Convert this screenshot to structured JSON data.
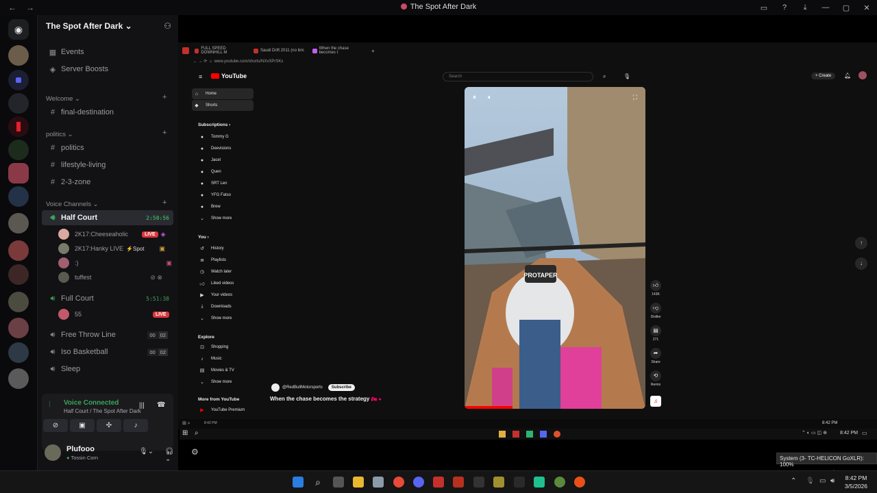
{
  "window": {
    "title": "The Spot After Dark"
  },
  "guild": {
    "name": "The Spot After Dark",
    "invite_icon": "add-person-icon"
  },
  "top_items": [
    {
      "label": "Events",
      "icon": "calendar-icon"
    },
    {
      "label": "Server Boosts",
      "icon": "boost-icon"
    }
  ],
  "categories": {
    "welcome": "Welcome",
    "politics": "politics",
    "voice": "Voice Channels"
  },
  "channels": {
    "final_destination": "final-destination",
    "politics": "politics",
    "lifestyle": "lifestyle-living",
    "zone": "2-3-zone"
  },
  "voice_channels": {
    "half_court": {
      "name": "Half Court",
      "timer": "2:50:56"
    },
    "full_court": {
      "name": "Full Court",
      "timer": "5:51:38"
    },
    "free_throw": {
      "name": "Free Throw Line",
      "a": "00",
      "b": "02"
    },
    "iso": {
      "name": "Iso Basketball",
      "a": "00",
      "b": "02"
    },
    "sleep": {
      "name": "Sleep"
    }
  },
  "voice_users": [
    {
      "name": "2K17:Cheeseaholic",
      "badge": "LIVE"
    },
    {
      "name": "2K17:Hanky LIVE",
      "tag": "Spot"
    },
    {
      "name": ":)"
    },
    {
      "name": "tuffest"
    }
  ],
  "full_court_users": [
    {
      "name": "55",
      "badge": "LIVE"
    }
  ],
  "voice_panel": {
    "status": "Voice Connected",
    "location": "Half Court / The Spot After Dark"
  },
  "user": {
    "name": "Plufooo",
    "status": "Tossin Corn"
  },
  "browser": {
    "tabs": [
      "FULL SPEED DOWNHILL M",
      "Saudi Drift 2011 (no limi",
      "When the chase becomes t"
    ],
    "url": "www.youtube.com/shorts/NXvSPrSKs"
  },
  "youtube": {
    "logo": "YouTube",
    "search_placeholder": "Search",
    "create": "Create",
    "nav": [
      "Home",
      "Shorts"
    ],
    "subscriptions_header": "Subscriptions",
    "subscriptions": [
      "Tommy G",
      "Deevisions",
      "Jacel",
      "Quen",
      "SRT Len",
      "YFG Fatso",
      "Brew"
    ],
    "show_more": "Show more",
    "you_header": "You",
    "you_items": [
      "History",
      "Playlists",
      "Watch later",
      "Liked videos",
      "Your videos",
      "Downloads"
    ],
    "explore_header": "Explore",
    "explore_items": [
      "Shopping",
      "Music",
      "Movies & TV"
    ],
    "more_header": "More from YouTube",
    "more_items": [
      "YouTube Premium"
    ],
    "channel": "@RedBullMotorsports",
    "subscribe": "Subscribe",
    "video_title": "When the chase becomes the strategy",
    "actions": [
      {
        "icon": "like-icon",
        "label": "143K"
      },
      {
        "icon": "dislike-icon",
        "label": "Dislike"
      },
      {
        "icon": "comment-icon",
        "label": "271"
      },
      {
        "icon": "share-icon",
        "label": "Share"
      },
      {
        "icon": "remix-icon",
        "label": "Remix"
      }
    ],
    "overlay_text": "PROTAPER",
    "inner_clock": "8:42 PM",
    "inner_time_left": "8:42 PM"
  },
  "tooltip": "System (3- TC-HELICON GoXLR): 100%",
  "clock": {
    "time": "8:42 PM",
    "date": "3/5/2026"
  }
}
